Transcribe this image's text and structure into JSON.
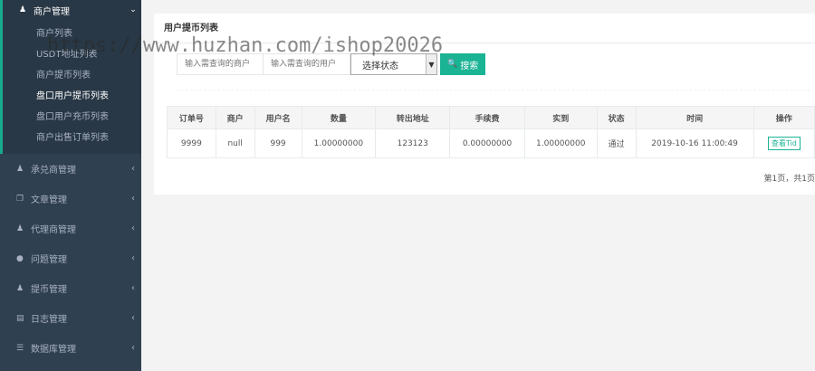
{
  "sidebar": {
    "active_menu": {
      "label": "商户管理",
      "icon": "user-icon",
      "arrow": "⌄"
    },
    "submenu": [
      {
        "label": "商户列表"
      },
      {
        "label": "USDT地址列表"
      },
      {
        "label": "商户提币列表"
      },
      {
        "label": "盘口用户提币列表",
        "active": true
      },
      {
        "label": "盘口用户充币列表"
      },
      {
        "label": "商户出售订单列表"
      }
    ],
    "items": [
      {
        "label": "承兑商管理",
        "icon": "user-icon",
        "arrow": "‹"
      },
      {
        "label": "文章管理",
        "icon": "copy-icon",
        "arrow": "‹"
      },
      {
        "label": "代理商管理",
        "icon": "user-icon",
        "arrow": "‹"
      },
      {
        "label": "问题管理",
        "icon": "comment-icon",
        "arrow": "‹"
      },
      {
        "label": "提币管理",
        "icon": "user-icon",
        "arrow": "‹"
      },
      {
        "label": "日志管理",
        "icon": "list-icon",
        "arrow": "‹"
      },
      {
        "label": "数据库管理",
        "icon": "database-icon",
        "arrow": "‹"
      }
    ]
  },
  "panel": {
    "title": "用户提币列表",
    "filters": {
      "merchant_placeholder": "输入需查询的商户",
      "user_placeholder": "输入需查询的用户",
      "status_value": "选择状态",
      "search_label": "搜索"
    },
    "table": {
      "headers": [
        "订单号",
        "商户",
        "用户名",
        "数量",
        "转出地址",
        "手续费",
        "实到",
        "状态",
        "时间",
        "操作"
      ],
      "rows": [
        [
          "9999",
          "null",
          "999",
          "1.00000000",
          "123123",
          "0.00000000",
          "1.00000000",
          "通过",
          "2019-10-16 11:00:49",
          "查看Tid"
        ]
      ]
    },
    "pager": "第1页，共1页"
  },
  "watermark": "https://www.huzhan.com/ishop20026",
  "colors": {
    "sidebar_bg": "#2f4050",
    "accent": "#1ab394"
  }
}
